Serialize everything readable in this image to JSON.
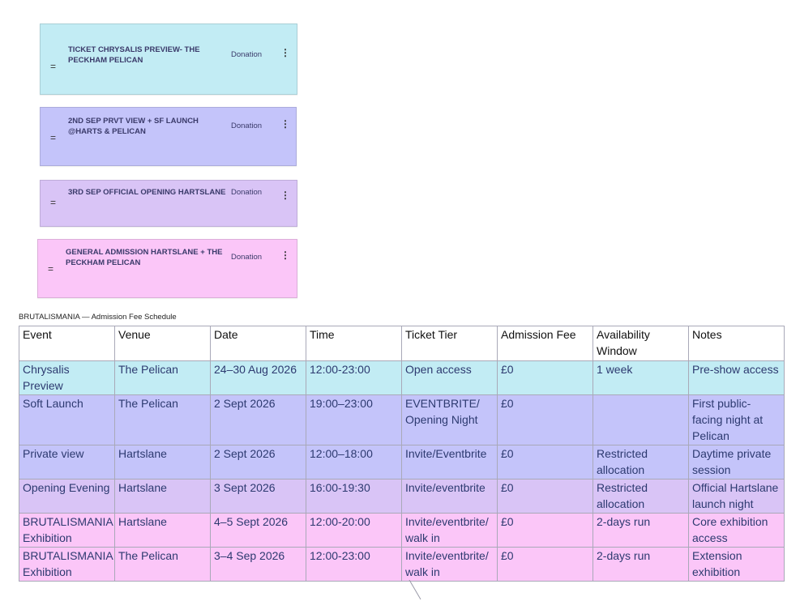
{
  "cards": [
    {
      "title": "TICKET CHRYSALIS PREVIEW- THE PECKHAM PELICAN",
      "price": "Donation",
      "drag": "=",
      "menu": "⋮",
      "color": "#c2ecf4"
    },
    {
      "title": "2ND SEP PRVT VIEW + SF LAUNCH @HARTS & PELICAN",
      "price": "Donation",
      "drag": "=",
      "menu": "⋮",
      "color": "#c4c4fa"
    },
    {
      "title": "3RD SEP OFFICIAL OPENING HARTSLANE",
      "price": "Donation",
      "drag": "=",
      "menu": "⋮",
      "color": "#d9c4f6"
    },
    {
      "title": "GENERAL ADMISSION HARTSLANE + THE PECKHAM PELICAN",
      "price": "Donation",
      "drag": "=",
      "menu": "⋮",
      "color": "#fbc6f8"
    }
  ],
  "table": {
    "caption": "BRUTALISMANIA — Admission Fee Schedule",
    "headers": [
      "Event",
      "Venue",
      "Date",
      "Time",
      "Ticket Tier",
      "Admission Fee",
      "Availability Window",
      "Notes"
    ],
    "rows": [
      {
        "color": "#c2ecf4",
        "cells": [
          "Chrysalis Preview",
          "The Pelican",
          "24–30 Aug 2026",
          "12:00-23:00",
          "Open access",
          "£0",
          "1 week",
          "Pre-show access"
        ]
      },
      {
        "color": "#c4c4fa",
        "cells": [
          "Soft Launch",
          "The Pelican",
          "2 Sept 2026",
          "19:00–23:00",
          "EVENTBRITE/ Opening Night",
          "£0",
          "",
          "First public-facing night at Pelican"
        ]
      },
      {
        "color": "#c4c4fa",
        "cells": [
          "Private view",
          "Hartslane",
          "2 Sept 2026",
          "12:00–18:00",
          "Invite/Eventbrite",
          "£0",
          "Restricted allocation",
          "Daytime private session"
        ]
      },
      {
        "color": "#d9c4f6",
        "cells": [
          "Opening Evening",
          "Hartslane",
          "3 Sept 2026",
          "16:00-19:30",
          "Invite/eventbrite",
          "£0",
          "Restricted allocation",
          "Official Hartslane launch night"
        ]
      },
      {
        "color": "#fbc6f8",
        "cells": [
          "BRUTALISMANIA Exhibition",
          "Hartslane",
          "4–5 Sept 2026",
          "12:00-20:00",
          "Invite/eventbrite/ walk in",
          "£0",
          "2-days run",
          "Core exhibition access"
        ]
      },
      {
        "color": "#fbc6f8",
        "cells": [
          "BRUTALISMANIA Exhibition",
          "The Pelican",
          "3–4 Sep 2026",
          "12:00-23:00",
          "Invite/eventbrite/ walk in",
          "£0",
          "2-days run",
          "Extension exhibition"
        ]
      }
    ]
  }
}
